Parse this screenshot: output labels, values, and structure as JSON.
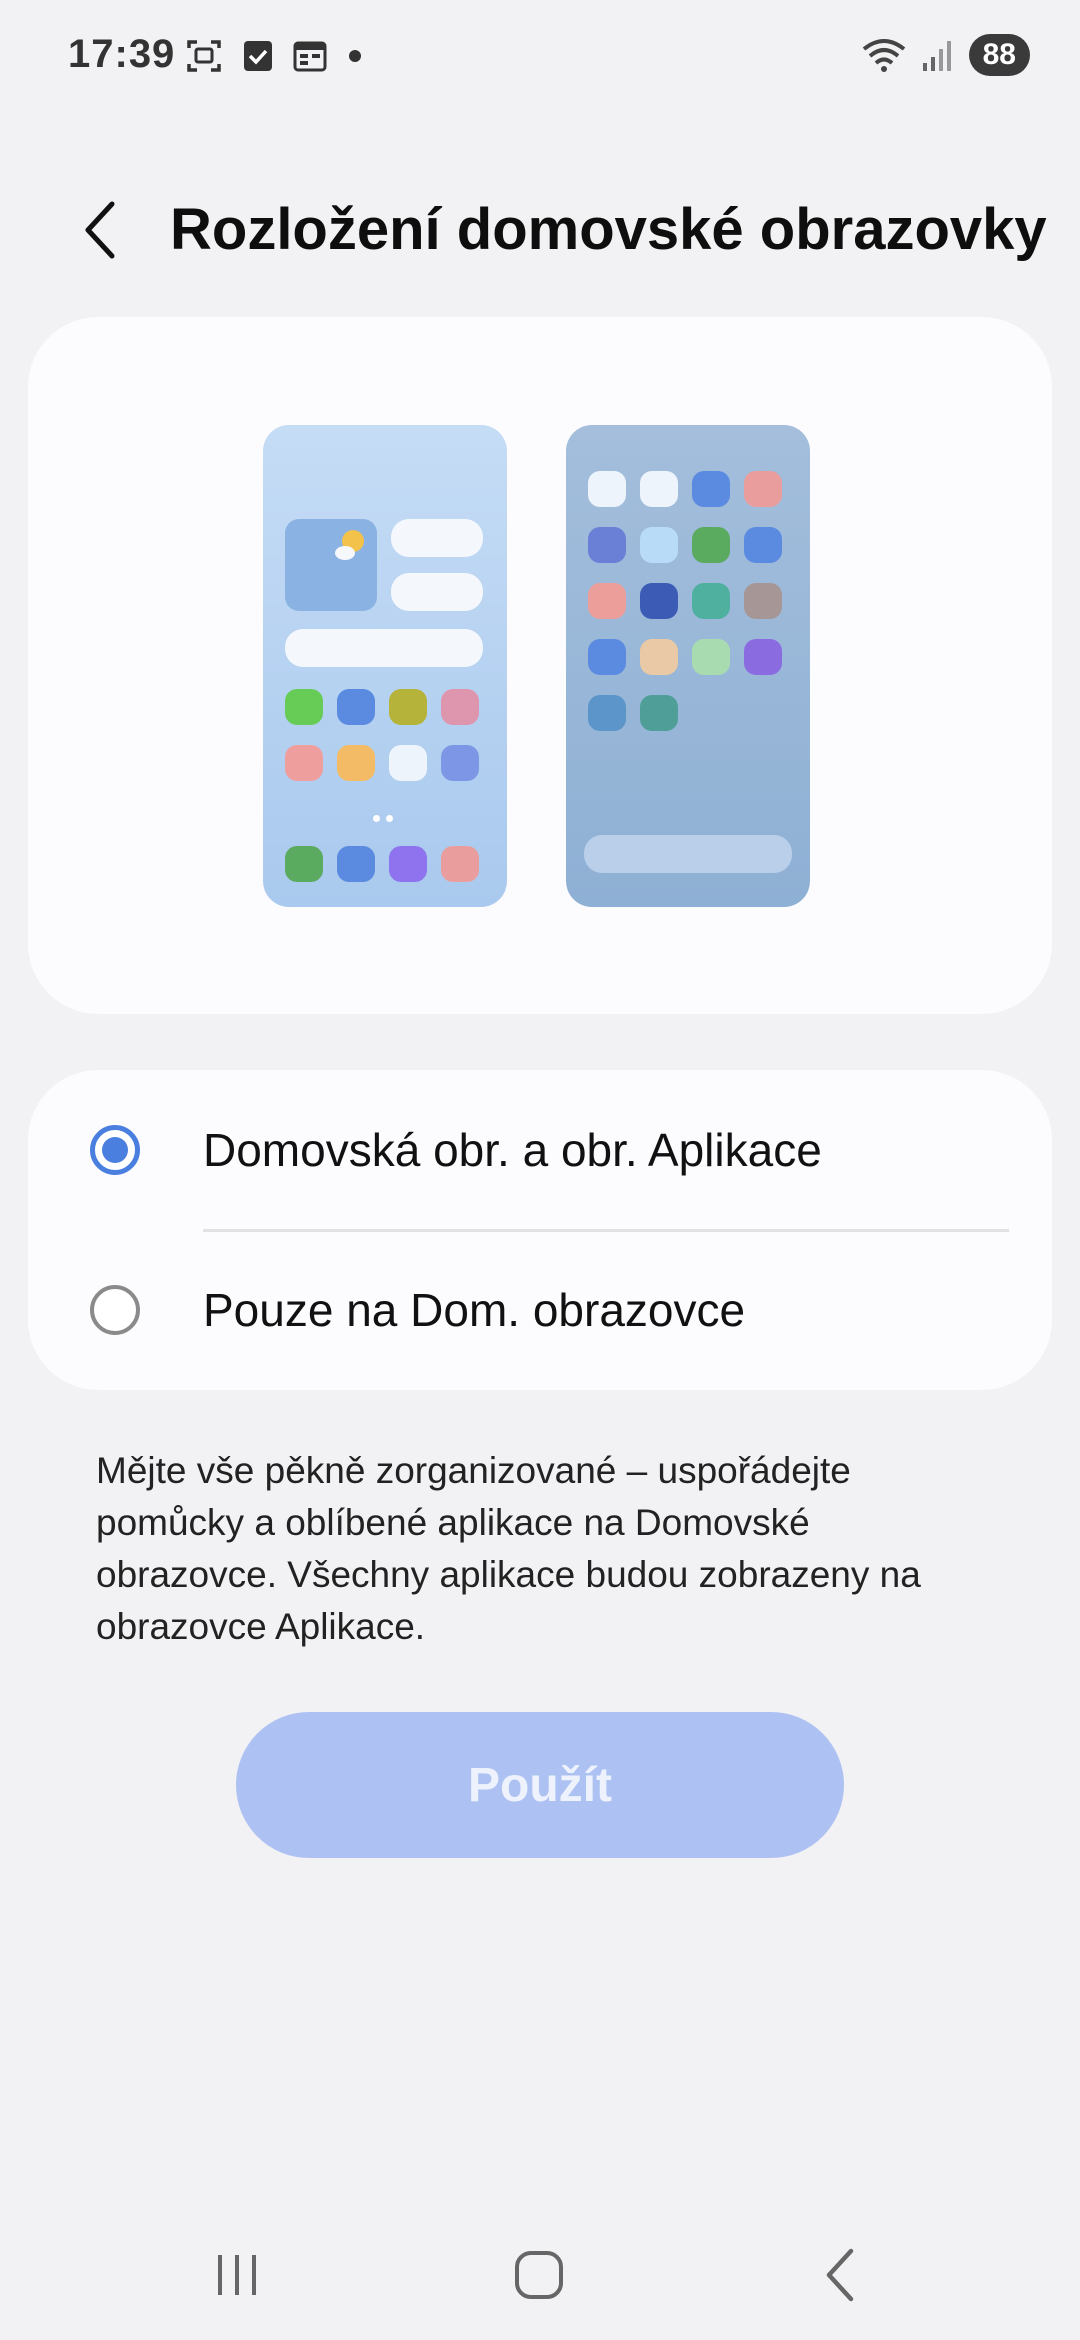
{
  "status_bar": {
    "time": "17:39",
    "battery": "88",
    "left_icons": [
      "screenshot-icon",
      "checkbox-icon",
      "calendar-icon",
      "dot-icon"
    ],
    "right_icons": [
      "wifi-icon",
      "signal-icon",
      "battery-icon"
    ]
  },
  "header": {
    "back_icon": "chevron-left-icon",
    "title": "Rozložení domovské obrazovky"
  },
  "preview": {
    "left_phone_colors": [
      "#66cc55",
      "#5b8be0",
      "#b5b33a",
      "#de95ae",
      "#ee9e9c",
      "#f3bb66",
      "#eef4fb",
      "#7d97e6",
      "#5aab60",
      "#5b8be0",
      "#8f72ee",
      "#ea9d9d"
    ],
    "right_phone_colors": [
      "#eef4fb",
      "#eef4fb",
      "#5b8be0",
      "#ea9d9d",
      "#6a7fd6",
      "#b8dcf7",
      "#5aab60",
      "#5b8be0",
      "#ec9e9a",
      "#3b5bb5",
      "#50b0a0",
      "#a69695",
      "#5b8be0",
      "#e9c9a6",
      "#a8dcb0",
      "#8a6ce0",
      "#5b95c9",
      "#4f9f98"
    ]
  },
  "options": [
    {
      "label": "Domovská obr. a obr. Aplikace",
      "selected": true
    },
    {
      "label": "Pouze na Dom. obrazovce",
      "selected": false
    }
  ],
  "description": "Mějte vše pěkně zorganizované – uspořádejte pomůcky a oblíbené aplikace na Domovské obrazovce. Všechny aplikace budou zobrazeny na obrazovce Aplikace.",
  "apply_button": {
    "label": "Použít",
    "color": "#adc2f2"
  },
  "nav_bar": {
    "icons": [
      "recents-icon",
      "home-icon",
      "back-icon"
    ]
  }
}
